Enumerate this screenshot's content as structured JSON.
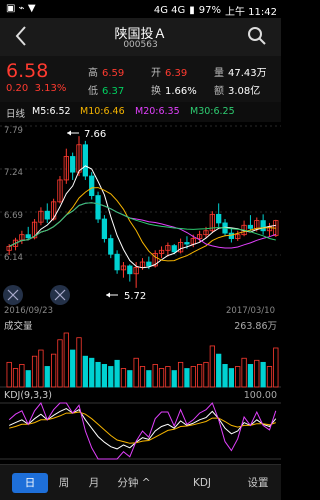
{
  "status": {
    "time": "上午 11:42",
    "battery": "97%",
    "net": "4G 4G"
  },
  "header": {
    "title": "陕国投Ａ",
    "code": "000563"
  },
  "quote": {
    "price": "6.58",
    "change": "0.20",
    "change_pct": "3.13%",
    "high_label": "高",
    "high": "6.59",
    "low_label": "低",
    "low": "6.37",
    "open_label": "开",
    "open": "6.39",
    "turnover_label": "换",
    "turnover": "1.66%",
    "volume_label": "量",
    "volume": "47.43万",
    "amount_label": "额",
    "amount": "3.08亿"
  },
  "ma": {
    "period": "日线",
    "ma5": "M5:6.52",
    "ma10": "M10:6.46",
    "ma20": "M20:6.35",
    "ma30": "M30:6.25"
  },
  "price_axis": {
    "top": "7.79",
    "mid1": "7.24",
    "mid2": "6.69",
    "low": "6.14"
  },
  "annotations": {
    "high_marker": "7.66",
    "low_marker": "5.72"
  },
  "date_axis": {
    "start": "2016/09/23",
    "end": "2017/03/10"
  },
  "volume": {
    "label": "成交量",
    "max": "263.86万"
  },
  "kdj": {
    "label": "KDJ(9,3,3)",
    "max": "100.00"
  },
  "tabs": [
    {
      "label": "日"
    },
    {
      "label": "周"
    },
    {
      "label": "月"
    },
    {
      "label": "分钟 ^"
    },
    {
      "label": "KDJ"
    },
    {
      "label": "设置"
    }
  ],
  "colors": {
    "up": "#ff3b30",
    "down": "#00d2d2",
    "ma5": "#ffffff",
    "ma10": "#f5b400",
    "ma20": "#e040fb",
    "ma30": "#2ecc71"
  },
  "chart_data": {
    "type": "candlestick",
    "ohlc": [
      [
        6.2,
        6.28,
        6.14,
        6.25
      ],
      [
        6.25,
        6.36,
        6.2,
        6.33
      ],
      [
        6.33,
        6.45,
        6.28,
        6.4
      ],
      [
        6.4,
        6.5,
        6.33,
        6.36
      ],
      [
        6.36,
        6.6,
        6.34,
        6.56
      ],
      [
        6.56,
        6.75,
        6.52,
        6.7
      ],
      [
        6.7,
        6.8,
        6.55,
        6.6
      ],
      [
        6.6,
        6.86,
        6.58,
        6.82
      ],
      [
        6.82,
        7.15,
        6.8,
        7.1
      ],
      [
        7.1,
        7.5,
        7.05,
        7.4
      ],
      [
        7.4,
        7.45,
        7.1,
        7.2
      ],
      [
        7.2,
        7.66,
        7.15,
        7.55
      ],
      [
        7.55,
        7.6,
        7.1,
        7.15
      ],
      [
        7.15,
        7.2,
        6.85,
        6.9
      ],
      [
        6.9,
        6.95,
        6.55,
        6.6
      ],
      [
        6.6,
        6.65,
        6.3,
        6.35
      ],
      [
        6.35,
        6.4,
        6.1,
        6.15
      ],
      [
        6.15,
        6.2,
        5.9,
        5.95
      ],
      [
        5.95,
        6.05,
        5.85,
        6.0
      ],
      [
        6.0,
        6.02,
        5.8,
        5.9
      ],
      [
        5.9,
        6.05,
        5.72,
        5.98
      ],
      [
        5.98,
        6.1,
        5.95,
        6.05
      ],
      [
        6.05,
        6.12,
        5.96,
        6.0
      ],
      [
        6.0,
        6.2,
        5.98,
        6.16
      ],
      [
        6.16,
        6.25,
        6.1,
        6.2
      ],
      [
        6.2,
        6.3,
        6.12,
        6.26
      ],
      [
        6.26,
        6.28,
        6.15,
        6.18
      ],
      [
        6.18,
        6.35,
        6.16,
        6.3
      ],
      [
        6.3,
        6.38,
        6.22,
        6.28
      ],
      [
        6.28,
        6.4,
        6.24,
        6.35
      ],
      [
        6.35,
        6.45,
        6.3,
        6.4
      ],
      [
        6.4,
        6.5,
        6.36,
        6.45
      ],
      [
        6.45,
        6.7,
        6.42,
        6.66
      ],
      [
        6.66,
        6.8,
        6.5,
        6.55
      ],
      [
        6.55,
        6.6,
        6.38,
        6.42
      ],
      [
        6.42,
        6.48,
        6.3,
        6.35
      ],
      [
        6.35,
        6.45,
        6.32,
        6.4
      ],
      [
        6.4,
        6.58,
        6.38,
        6.52
      ],
      [
        6.52,
        6.65,
        6.45,
        6.48
      ],
      [
        6.48,
        6.62,
        6.44,
        6.58
      ],
      [
        6.58,
        6.66,
        6.4,
        6.45
      ],
      [
        6.45,
        6.55,
        6.38,
        6.5
      ],
      [
        6.39,
        6.59,
        6.37,
        6.58
      ]
    ],
    "volume": [
      120,
      90,
      110,
      80,
      150,
      180,
      100,
      160,
      230,
      263,
      180,
      240,
      150,
      140,
      120,
      110,
      100,
      130,
      90,
      80,
      140,
      100,
      80,
      110,
      90,
      100,
      80,
      120,
      90,
      100,
      110,
      120,
      200,
      160,
      110,
      90,
      100,
      140,
      110,
      130,
      120,
      100,
      190
    ],
    "kdj_k": [
      60,
      65,
      70,
      62,
      72,
      80,
      70,
      78,
      85,
      90,
      82,
      88,
      70,
      55,
      40,
      30,
      22,
      18,
      25,
      20,
      30,
      38,
      35,
      50,
      58,
      62,
      55,
      68,
      60,
      64,
      70,
      74,
      85,
      72,
      55,
      45,
      50,
      65,
      60,
      70,
      62,
      58,
      72
    ],
    "kdj_d": [
      55,
      58,
      62,
      62,
      65,
      70,
      70,
      73,
      77,
      82,
      82,
      84,
      80,
      72,
      62,
      52,
      42,
      34,
      31,
      28,
      29,
      32,
      33,
      39,
      45,
      51,
      53,
      58,
      59,
      61,
      64,
      67,
      73,
      73,
      67,
      60,
      57,
      60,
      60,
      63,
      63,
      61,
      65
    ],
    "kdj_j": [
      70,
      80,
      86,
      62,
      86,
      100,
      70,
      88,
      100,
      100,
      82,
      96,
      50,
      20,
      0,
      0,
      0,
      0,
      13,
      4,
      32,
      50,
      39,
      72,
      84,
      84,
      59,
      88,
      62,
      70,
      82,
      88,
      100,
      70,
      31,
      15,
      36,
      75,
      60,
      84,
      60,
      52,
      86
    ],
    "price_min": 5.59,
    "price_max": 7.79
  }
}
